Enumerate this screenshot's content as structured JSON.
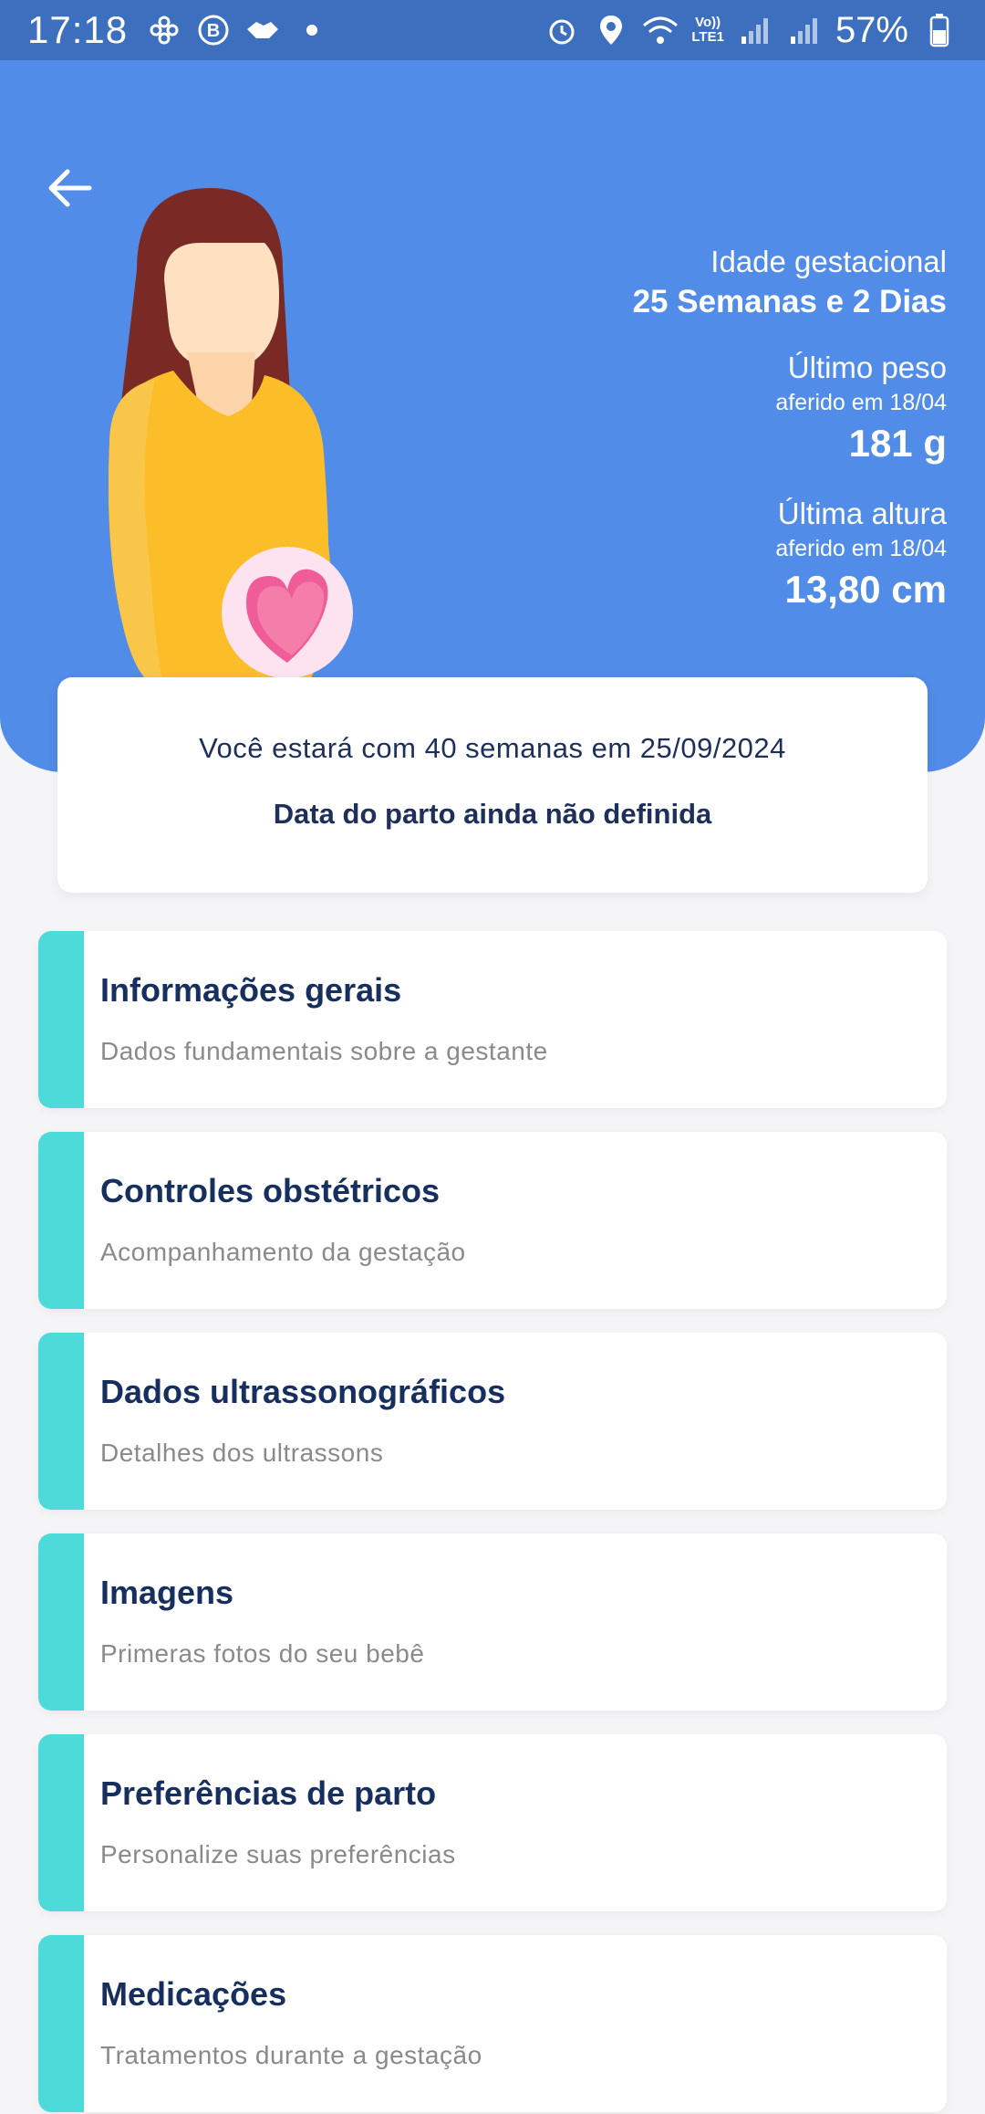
{
  "status_bar": {
    "time": "17:18",
    "battery": "57%",
    "network_label_top": "Vo))",
    "network_label_bottom": "LTE1"
  },
  "header": {
    "back_icon": "arrow-left-icon",
    "gestational_age_label": "Idade gestacional",
    "gestational_age_value": "25 Semanas e 2 Dias",
    "weight_label": "Último peso",
    "weight_date": "aferido em 18/04",
    "weight_value": "181 g",
    "height_label": "Última altura",
    "height_date": "aferido em 18/04",
    "height_value": "13,80 cm"
  },
  "info_card": {
    "line1": "Você estará com 40 semanas em 25/09/2024",
    "line2": "Data do parto ainda não definida"
  },
  "menu": [
    {
      "title": "Informações gerais",
      "subtitle": "Dados fundamentais sobre a gestante"
    },
    {
      "title": "Controles obstétricos",
      "subtitle": "Acompanhamento da gestação"
    },
    {
      "title": "Dados ultrassonográficos",
      "subtitle": "Detalhes dos ultrassons"
    },
    {
      "title": "Imagens",
      "subtitle": "Primeras fotos do seu bebê"
    },
    {
      "title": "Preferências de parto",
      "subtitle": "Personalize suas preferências"
    },
    {
      "title": "Medicações",
      "subtitle": "Tratamentos durante a gestação"
    }
  ],
  "colors": {
    "header_bg": "#518ce8",
    "status_bg": "#3d6fbf",
    "accent": "#4ddbd9",
    "title_text": "#172f5f"
  }
}
